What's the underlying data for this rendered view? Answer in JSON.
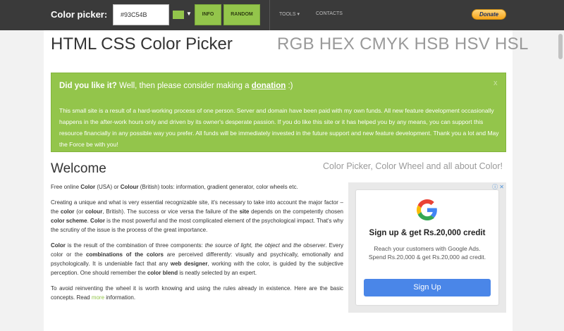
{
  "navbar": {
    "brand": "Color picker:",
    "hex_value": "#93C54B",
    "swatch_color": "#93C54B",
    "info_label": "INFO",
    "random_label": "RANDOM",
    "tools_label": "TOOLS ▾",
    "contacts_label": "CONTACTS",
    "donate_label": "Donate"
  },
  "header": {
    "title": "HTML CSS Color Picker",
    "models": "RGB HEX CMYK HSB HSV HSL"
  },
  "alert": {
    "prefix": "Did you like it?",
    "middle": " Well, then please consider making a ",
    "link": "donation",
    "suffix": " :)",
    "close": "x",
    "body": "This small site is a result of a hard-working process of one person. Server and domain have been paid with my own funds. All new feature development occasionally happens in the after-work hours only and driven by its owner's desperate passion. If you do like this site or it has helped you by any means, you can support this resource financially in any possible way you prefer. All funds will be immediately invested in the future support and new feature development. Thank you a lot and May the Force be with you!"
  },
  "welcome": {
    "title": "Welcome",
    "tagline": "Color Picker, Color Wheel and all about Color!",
    "p1": {
      "t1": "Free online ",
      "b1": "Color",
      "t2": " (USA) or ",
      "b2": "Colour",
      "t3": " (British) tools: information, gradient generator, color wheels etc."
    },
    "p2": {
      "t1": "Creating a unique and what is very essential recognizable site, it's necessary to take into account the major factor – the ",
      "b1": "color",
      "t2": " (or ",
      "b2": "colour",
      "t3": ", British). The success or vice versa the failure of the ",
      "b3": "site",
      "t4": " depends on the competently chosen ",
      "b4": "color scheme",
      "t5": ". ",
      "b5": "Color",
      "t6": " is the most powerful and the most complicated element of the psychological impact. That's why the scrutiny of the issue is the process of the great importance."
    },
    "p3": {
      "b1": "Color",
      "t1": " is the result of the combination of three components: ",
      "i1": "the source of light, the object",
      "t2": " and ",
      "i2": "the observer",
      "t3": ". Every color or the ",
      "b2": "combinations of the colors",
      "t4": " are perceived differently: visually and psychically, emotionally and psychologically. It is undeniable fact that any ",
      "b3": "web designer",
      "t5": ", working with the color, is guided by the subjective perception. One should remember the ",
      "b4": "color blend",
      "t6": " is neatly selected by an expert."
    },
    "p4": {
      "t1": "To avoid reinventing the wheel it is worth knowing and using the rules already in existence. Here are the basic concepts. Read ",
      "link": "more",
      "t2": " information."
    }
  },
  "ad": {
    "choices": "ⓘ ✕",
    "headline": "Sign up & get Rs.20,000 credit",
    "text": "Reach your customers with Google Ads. Spend Rs.20,000 & get Rs.20,000 ad credit.",
    "cta": "Sign Up"
  }
}
